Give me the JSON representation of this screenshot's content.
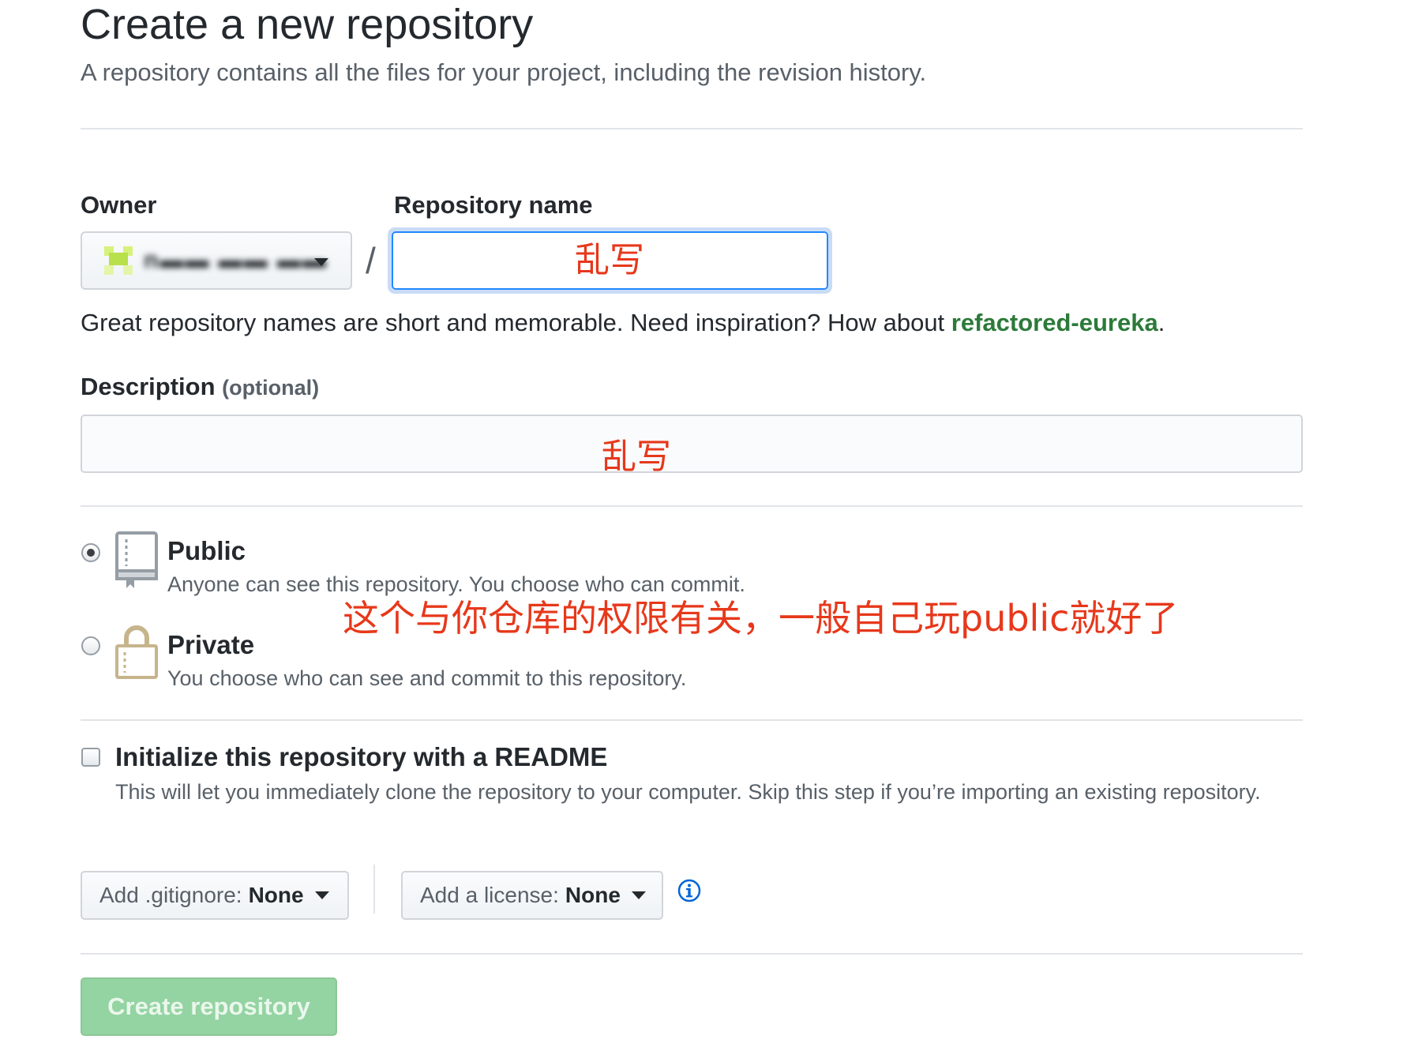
{
  "header": {
    "title": "Create a new repository",
    "subtitle": "A repository contains all the files for your project, including the revision history."
  },
  "owner": {
    "label": "Owner",
    "value": "n▬▬ ▬▬ ▬▬"
  },
  "repo_name": {
    "label": "Repository name",
    "separator": "/",
    "value": "",
    "annotation": "乱写"
  },
  "name_hint": {
    "text": "Great repository names are short and memorable. Need inspiration? How about ",
    "suggestion": "refactored-eureka",
    "end": "."
  },
  "description": {
    "label": "Description",
    "optional": "(optional)",
    "value": "",
    "annotation": "乱写"
  },
  "visibility": {
    "selected": "public",
    "annotation": "这个与你仓库的权限有关，一般自己玩public就好了",
    "options": [
      {
        "title": "Public",
        "desc": "Anyone can see this repository. You choose who can commit."
      },
      {
        "title": "Private",
        "desc": "You choose who can see and commit to this repository."
      }
    ]
  },
  "readme": {
    "checked": false,
    "title": "Initialize this repository with a README",
    "desc": "This will let you immediately clone the repository to your computer. Skip this step if you’re importing an existing repository."
  },
  "gitignore": {
    "prefix": "Add .gitignore:",
    "value": "None"
  },
  "license": {
    "prefix": "Add a license:",
    "value": "None"
  },
  "icons": {
    "owner": "avatar-icon",
    "public": "repo-book-icon",
    "private": "lock-icon",
    "info": "info-icon"
  },
  "create_button": {
    "label": "Create repository"
  },
  "colors": {
    "annotation": "#e7381b",
    "focus": "#2188ff",
    "suggestion": "#2c7a3a",
    "create_button": "#94d3a2"
  }
}
